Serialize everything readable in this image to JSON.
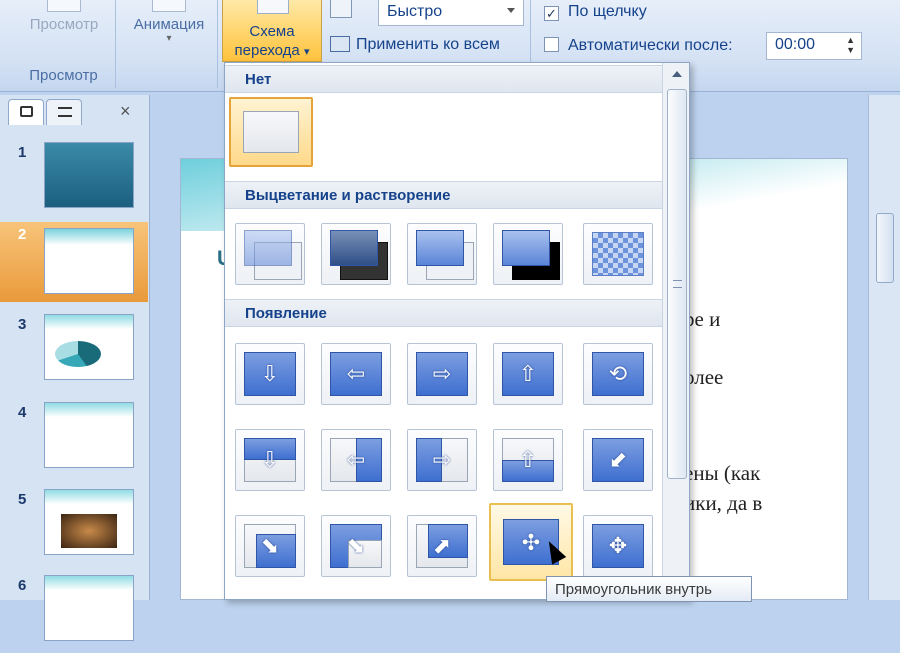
{
  "ribbon": {
    "preview_group": {
      "button_label": "Просмотр",
      "group_label": "Просмотр"
    },
    "animation_button": "Анимация",
    "schema_button": {
      "line1": "Схема",
      "line2": "перехода",
      "arrow": "▾"
    },
    "apply_all_label": "Применить ко всем",
    "speed_combo": {
      "value": "Быстро"
    },
    "on_click": {
      "label": "По щелчку",
      "checked": "✓"
    },
    "auto_after": {
      "label": "Автоматически после:",
      "value": "00:00"
    }
  },
  "leftpanel": {
    "close_glyph": "×",
    "slides": [
      {
        "number": "1"
      },
      {
        "number": "2"
      },
      {
        "number": "3"
      },
      {
        "number": "4"
      },
      {
        "number": "5"
      },
      {
        "number": "6"
      }
    ]
  },
  "slide": {
    "fragments": [
      "ре и",
      "олее",
      "ены (как",
      "ики, да в"
    ],
    "partial_letter": "U"
  },
  "gallery": {
    "sections": [
      "Нет",
      "Выцветание и растворение",
      "Появление"
    ],
    "tooltip": "Прямоугольник внутрь"
  },
  "colors": {
    "accent": "#ffd46a",
    "ribbon_text": "#15428b",
    "tile_blue": "#3e6fd0"
  }
}
